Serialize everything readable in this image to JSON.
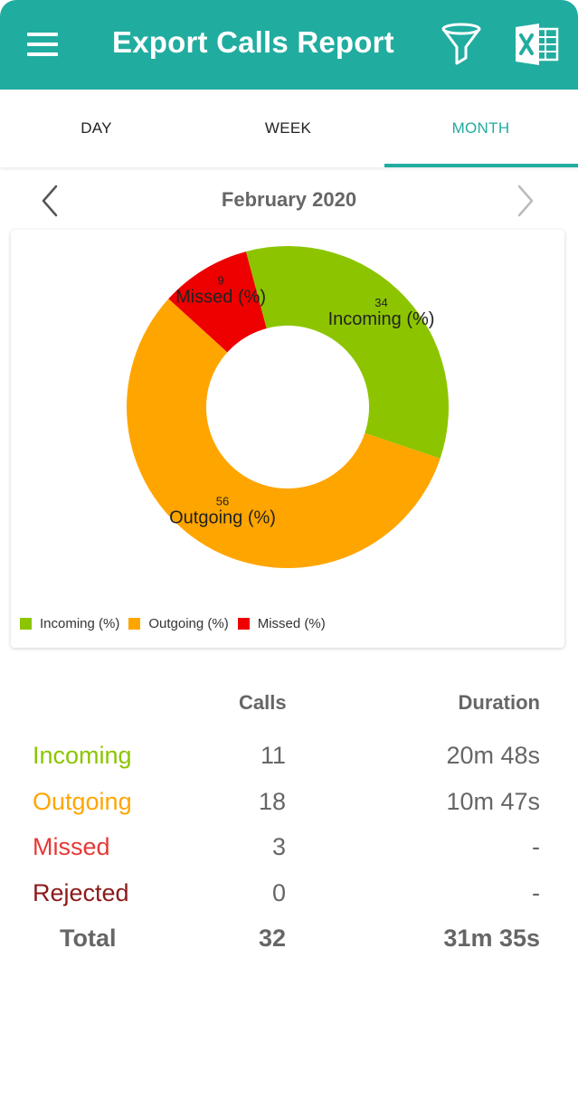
{
  "app": {
    "title": "Export Calls Report",
    "icons": {
      "menu": "menu-icon",
      "filter": "filter-icon",
      "excel": "excel-icon"
    }
  },
  "tabs": [
    {
      "label": "DAY",
      "active": false
    },
    {
      "label": "WEEK",
      "active": false
    },
    {
      "label": "MONTH",
      "active": true
    }
  ],
  "period": {
    "label": "February 2020",
    "prev_icon": "chevron-left-icon",
    "next_icon": "chevron-right-icon"
  },
  "colors": {
    "accent": "#21aca0",
    "incoming": "#8cc500",
    "outgoing": "#ffa500",
    "missed": "#ee0000",
    "rejected": "#8b1a1a"
  },
  "chart_data": {
    "type": "pie",
    "series": [
      {
        "name": "Incoming (%)",
        "value": 34,
        "color": "#8cc500"
      },
      {
        "name": "Outgoing (%)",
        "value": 56,
        "color": "#ffa500"
      },
      {
        "name": "Missed (%)",
        "value": 9,
        "color": "#ee0000"
      }
    ],
    "legend": "bottom-left"
  },
  "stats": {
    "headers": {
      "calls": "Calls",
      "duration": "Duration"
    },
    "rows": [
      {
        "label": "Incoming",
        "calls": "11",
        "duration": "20m 48s",
        "color": "#8cc500"
      },
      {
        "label": "Outgoing",
        "calls": "18",
        "duration": "10m 47s",
        "color": "#ffa500"
      },
      {
        "label": "Missed",
        "calls": "3",
        "duration": "-",
        "color": "#e53935"
      },
      {
        "label": "Rejected",
        "calls": "0",
        "duration": "-",
        "color": "#8b1a1a"
      },
      {
        "label": "Total",
        "calls": "32",
        "duration": "31m 35s",
        "color": "#666666"
      }
    ]
  }
}
